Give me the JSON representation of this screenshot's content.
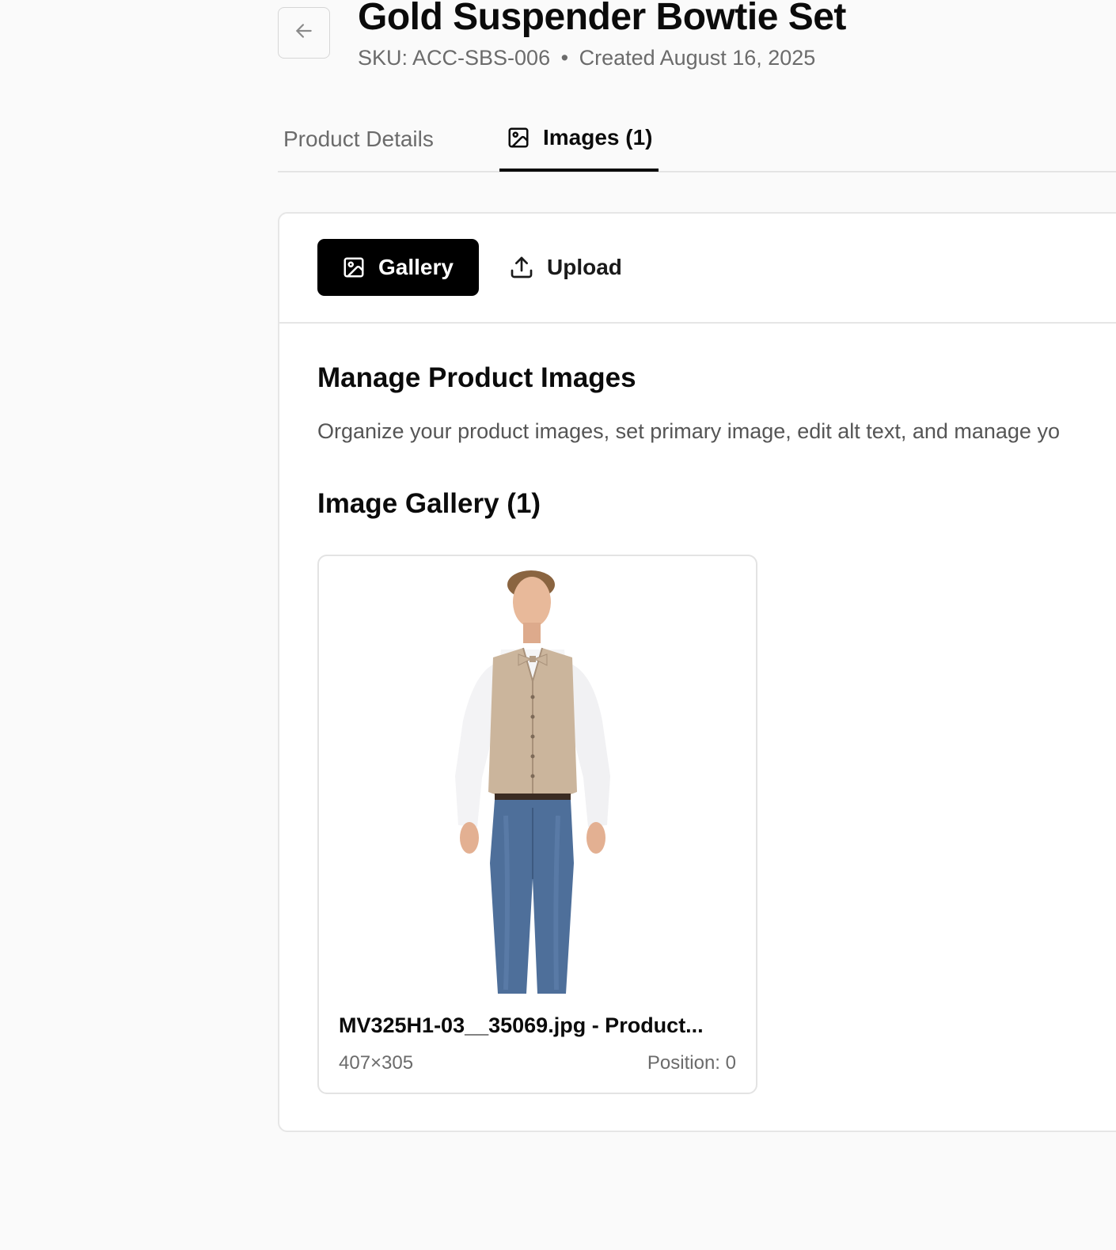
{
  "header": {
    "title": "Gold Suspender Bowtie Set",
    "sku_text": "SKU: ACC-SBS-006",
    "separator": "•",
    "created_text": "Created August 16, 2025",
    "back_icon": "arrow-left-icon"
  },
  "tabs": [
    {
      "label": "Product Details",
      "active": false
    },
    {
      "label": "Images (1)",
      "active": true,
      "icon": "image-icon"
    }
  ],
  "toolbar": {
    "gallery_label": "Gallery",
    "gallery_icon": "image-icon",
    "upload_label": "Upload",
    "upload_icon": "upload-icon"
  },
  "manage": {
    "heading": "Manage Product Images",
    "description": "Organize your product images, set primary image, edit alt text, and manage yo"
  },
  "gallery": {
    "heading": "Image Gallery (1)",
    "images": [
      {
        "file_name": "MV325H1-03__35069.jpg - Product...",
        "dimensions": "407×305",
        "position": "Position: 0"
      }
    ]
  },
  "colors": {
    "background": "#fafafa",
    "primary": "#000000",
    "muted_text": "#6b6b6b",
    "border": "#e6e6e6"
  }
}
